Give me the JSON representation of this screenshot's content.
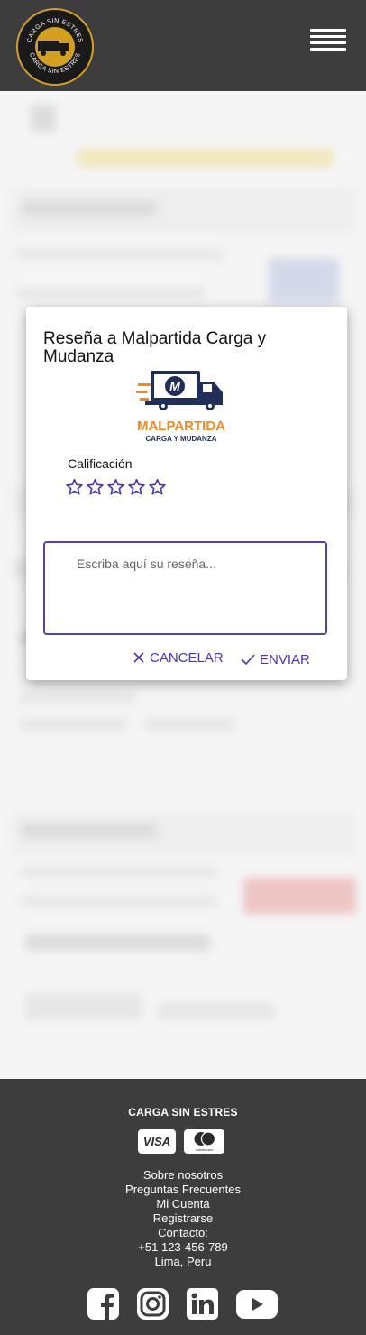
{
  "header": {
    "logo_text_top": "CARGA SIN ESTRES",
    "logo_text_bottom": "CARGA SIN ESTRES",
    "menu_icon": "hamburger-menu-icon"
  },
  "modal": {
    "title": "Reseña a Malpartida Carga y Mudanza",
    "company_logo": {
      "name": "MALPARTIDA",
      "tagline": "CARGA Y MUDANZA",
      "badge_letter": "M"
    },
    "rating_label": "Calificación",
    "rating": {
      "value": 0,
      "max": 5
    },
    "review_placeholder": "Escriba aquí su reseña...",
    "review_value": "",
    "cancel_label": "CANCELAR",
    "send_label": "ENVIAR"
  },
  "footer": {
    "brand": "CARGA SIN ESTRES",
    "payment_methods": [
      "VISA",
      "mastercard"
    ],
    "links": [
      "Sobre nosotros",
      "Preguntas Frecuentes",
      "Mi Cuenta",
      "Registrarse"
    ],
    "contact_label": "Contacto:",
    "phone": "+51 123-456-789",
    "location": "Lima, Peru",
    "socials": [
      "facebook-icon",
      "instagram-icon",
      "linkedin-icon",
      "youtube-icon"
    ]
  },
  "colors": {
    "header_bg": "#3d3d3d",
    "accent": "#4a36b0",
    "input_border": "#5b3fa8",
    "logo_gold": "#d4a020",
    "company_navy": "#1f2f5a",
    "company_orange": "#f08a1c"
  }
}
